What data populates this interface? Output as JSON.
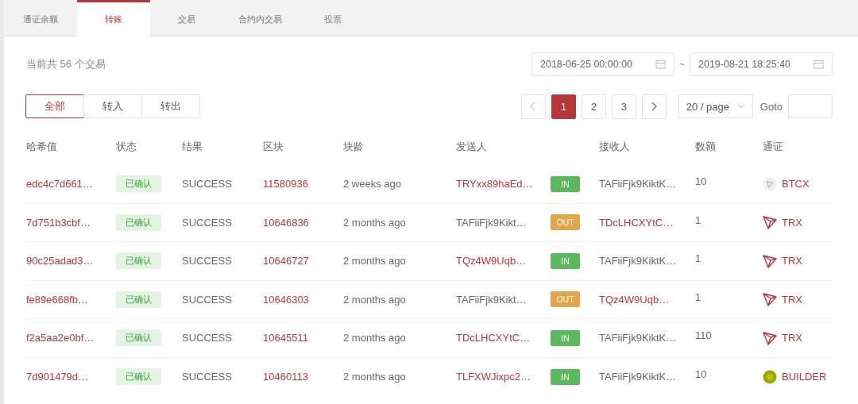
{
  "tabs": [
    {
      "label": "通证余额",
      "selected": false
    },
    {
      "label": "转账",
      "selected": true
    },
    {
      "label": "交易",
      "selected": false
    },
    {
      "label": "合约内交易",
      "selected": false
    },
    {
      "label": "投票",
      "selected": false
    }
  ],
  "summary": "当前共 56 个交易",
  "date_range": {
    "start": "2018-06-25 00:00:00",
    "separator": "~",
    "end": "2019-08-21 18:25:40"
  },
  "filters": [
    {
      "label": "全部",
      "selected": true
    },
    {
      "label": "转入",
      "selected": false
    },
    {
      "label": "转出",
      "selected": false
    }
  ],
  "pagination": {
    "pages": [
      {
        "label": "1",
        "selected": true
      },
      {
        "label": "2",
        "selected": false
      },
      {
        "label": "3",
        "selected": false
      }
    ],
    "page_size": "20 / page",
    "goto_label": "Goto"
  },
  "table": {
    "columns": [
      "哈希值",
      "状态",
      "结果",
      "区块",
      "块龄",
      "发送人",
      "接收人",
      "数额",
      "通证"
    ],
    "rows": [
      {
        "hash": "edc4c7d661…",
        "status": "已确认",
        "result": "SUCCESS",
        "block": "11580936",
        "age": "2 weeks ago",
        "sender": "TRYxx89haEd…",
        "sender_link": true,
        "direction": {
          "label": "IN",
          "kind": "in"
        },
        "receiver": "TAFiiFjk9KiktK…",
        "receiver_link": false,
        "amount": "10",
        "token": {
          "name": "BTCX",
          "kind": "faded"
        }
      },
      {
        "hash": "7d751b3cbf…",
        "status": "已确认",
        "result": "SUCCESS",
        "block": "10646836",
        "age": "2 months ago",
        "sender": "TAFiiFjk9Kikt…",
        "sender_link": false,
        "direction": {
          "label": "OUT",
          "kind": "out"
        },
        "receiver": "TDcLHCXYtC…",
        "receiver_link": true,
        "amount": "1",
        "token": {
          "name": "TRX",
          "kind": "tron"
        }
      },
      {
        "hash": "90c25adad3…",
        "status": "已确认",
        "result": "SUCCESS",
        "block": "10646727",
        "age": "2 months ago",
        "sender": "TQz4W9Uqb…",
        "sender_link": true,
        "direction": {
          "label": "IN",
          "kind": "in"
        },
        "receiver": "TAFiiFjk9KiktK…",
        "receiver_link": false,
        "amount": "1",
        "token": {
          "name": "TRX",
          "kind": "tron"
        }
      },
      {
        "hash": "fe89e668fb…",
        "status": "已确认",
        "result": "SUCCESS",
        "block": "10646303",
        "age": "2 months ago",
        "sender": "TAFiiFjk9Kikt…",
        "sender_link": false,
        "direction": {
          "label": "OUT",
          "kind": "out"
        },
        "receiver": "TQz4W9Uqb…",
        "receiver_link": true,
        "amount": "1",
        "token": {
          "name": "TRX",
          "kind": "tron"
        }
      },
      {
        "hash": "f2a5aa2e0bf…",
        "status": "已确认",
        "result": "SUCCESS",
        "block": "10645511",
        "age": "2 months ago",
        "sender": "TDcLHCXYtC…",
        "sender_link": true,
        "direction": {
          "label": "IN",
          "kind": "in"
        },
        "receiver": "TAFiiFjk9KiktK…",
        "receiver_link": false,
        "amount": "110",
        "token": {
          "name": "TRX",
          "kind": "tron"
        }
      },
      {
        "hash": "7d901479d…",
        "status": "已确认",
        "result": "SUCCESS",
        "block": "10460113",
        "age": "2 months ago",
        "sender": "TLFXWJixpc2…",
        "sender_link": true,
        "direction": {
          "label": "IN",
          "kind": "in"
        },
        "receiver": "TAFiiFjk9KiktK…",
        "receiver_link": false,
        "amount": "10",
        "token": {
          "name": "BUILDER",
          "kind": "coin"
        }
      }
    ]
  }
}
